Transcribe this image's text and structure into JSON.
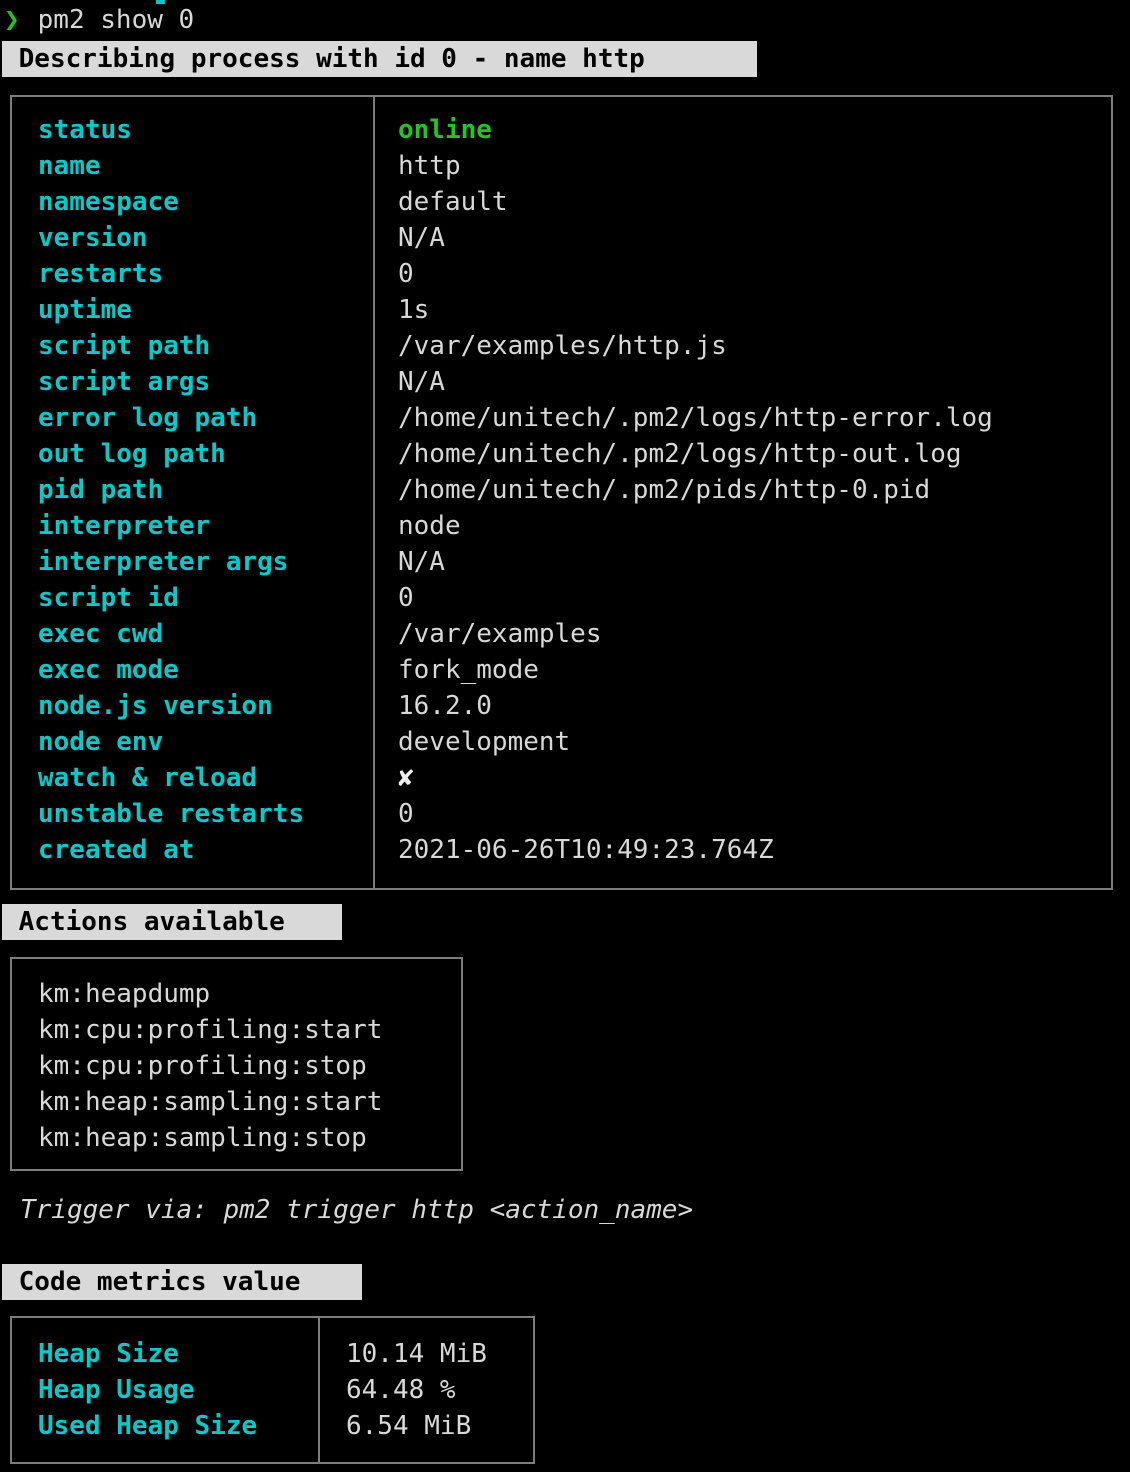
{
  "terminal": {
    "prompt_symbol": "❯",
    "command": "pm2 show 0"
  },
  "describe_header": " Describing process with id 0 - name http ",
  "process_info": {
    "rows": [
      {
        "label": "status",
        "value": "online",
        "value_style": "status-online"
      },
      {
        "label": "name",
        "value": "http"
      },
      {
        "label": "namespace",
        "value": "default"
      },
      {
        "label": "version",
        "value": "N/A"
      },
      {
        "label": "restarts",
        "value": "0"
      },
      {
        "label": "uptime",
        "value": "1s"
      },
      {
        "label": "script path",
        "value": "/var/examples/http.js"
      },
      {
        "label": "script args",
        "value": "N/A"
      },
      {
        "label": "error log path",
        "value": "/home/unitech/.pm2/logs/http-error.log"
      },
      {
        "label": "out log path",
        "value": "/home/unitech/.pm2/logs/http-out.log"
      },
      {
        "label": "pid path",
        "value": "/home/unitech/.pm2/pids/http-0.pid"
      },
      {
        "label": "interpreter",
        "value": "node"
      },
      {
        "label": "interpreter args",
        "value": "N/A"
      },
      {
        "label": "script id",
        "value": "0"
      },
      {
        "label": "exec cwd",
        "value": "/var/examples"
      },
      {
        "label": "exec mode",
        "value": "fork_mode"
      },
      {
        "label": "node.js version",
        "value": "16.2.0"
      },
      {
        "label": "node env",
        "value": "development"
      },
      {
        "label": "watch & reload",
        "value": "✘",
        "value_style": "cross-mark"
      },
      {
        "label": "unstable restarts",
        "value": "0"
      },
      {
        "label": "created at",
        "value": "2021-06-26T10:49:23.764Z"
      }
    ]
  },
  "actions": {
    "header": " Actions available ",
    "items": [
      "km:heapdump",
      "km:cpu:profiling:start",
      "km:cpu:profiling:stop",
      "km:heap:sampling:start",
      "km:heap:sampling:stop"
    ],
    "trigger_hint": "Trigger via: pm2 trigger http <action_name>"
  },
  "code_metrics": {
    "header": " Code metrics value ",
    "rows": [
      {
        "label": "Heap Size",
        "value": "10.14 MiB"
      },
      {
        "label": "Heap Usage",
        "value": "64.48 %"
      },
      {
        "label": "Used Heap Size",
        "value": "6.54 MiB"
      }
    ]
  },
  "colors": {
    "background": "#000000",
    "label_cyan": "#00cccc",
    "value_white": "#d8d8d8",
    "status_green": "#1ec81e",
    "banner_bg": "#d9d9d9",
    "border_gray": "#7d7d7d"
  }
}
